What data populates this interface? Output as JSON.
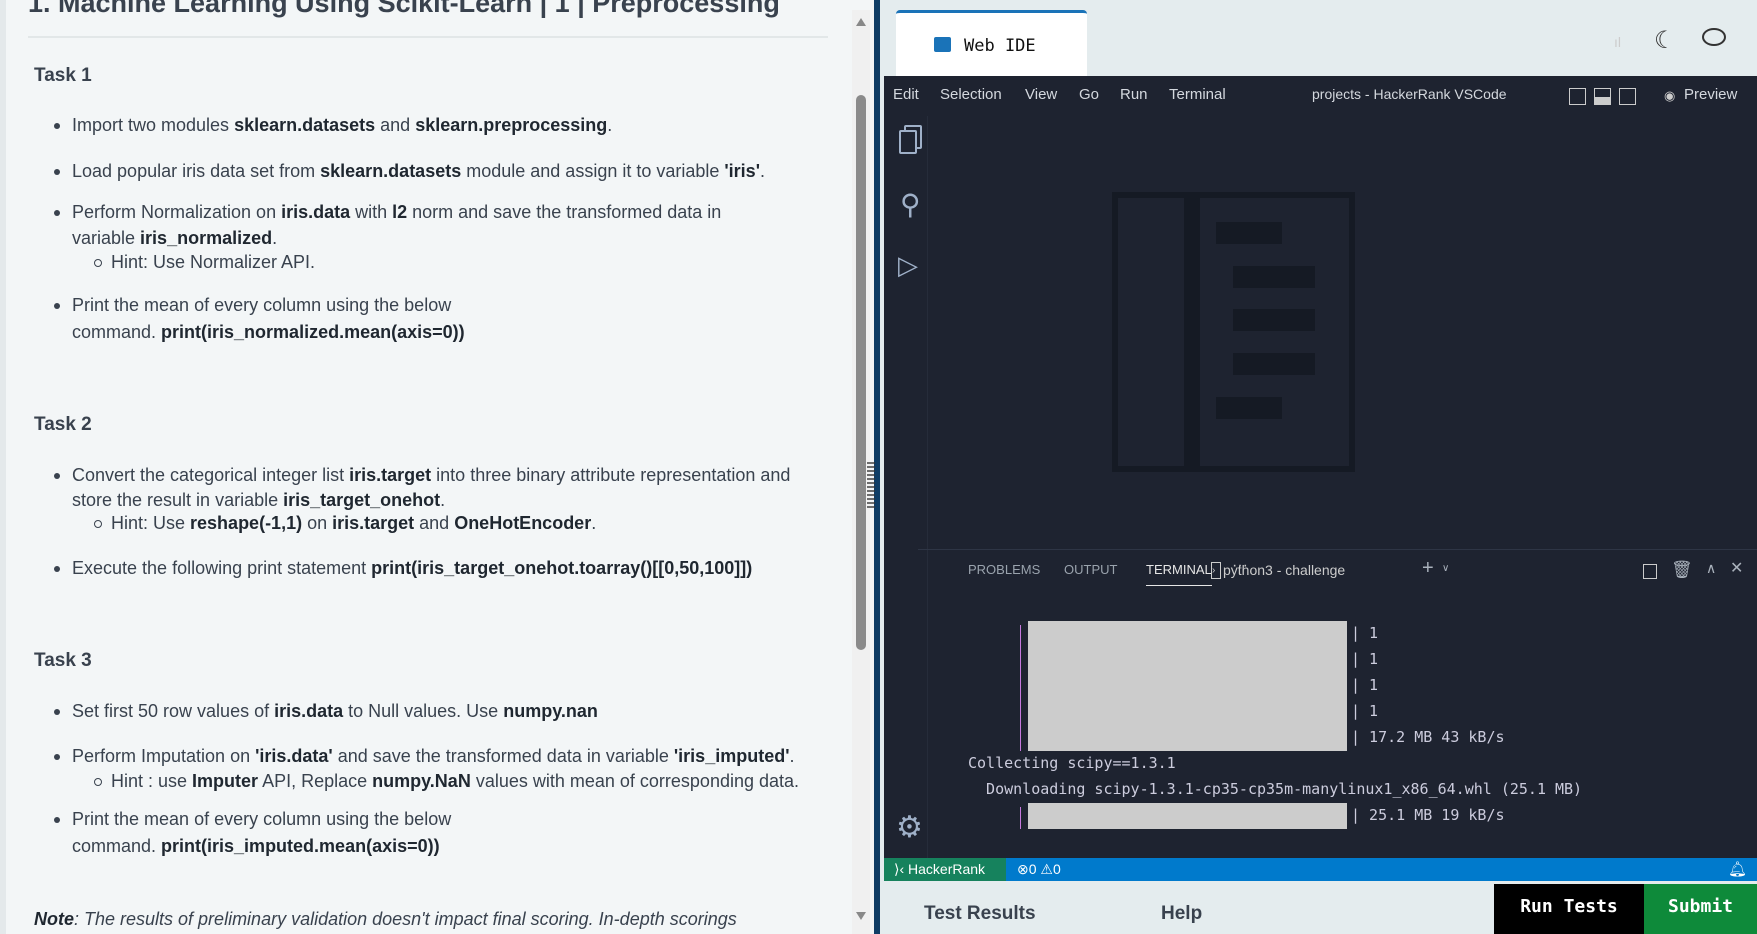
{
  "problem": {
    "title": "1. Machine Learning Using Scikit-Learn | 1 | Preprocessing",
    "task1": {
      "heading": "Task 1",
      "b1": [
        "Import two modules ",
        "sklearn.datasets",
        " and ",
        "sklearn.preprocessing",
        "."
      ],
      "b2": [
        "Load popular iris data set from ",
        "sklearn.datasets",
        " module and assign it to variable ",
        "'iris'",
        "."
      ],
      "b3a": [
        "Perform Normalization on ",
        "iris.data",
        " with ",
        "l2",
        " norm and save the transformed data in"
      ],
      "b3b": [
        "variable ",
        "iris_normalized",
        "."
      ],
      "hint": "Hint: Use Normalizer API.",
      "b4a": "Print the mean of every column using the below",
      "b4b": [
        "command. ",
        "print(iris_normalized.mean(axis=0))"
      ]
    },
    "task2": {
      "heading": "Task 2",
      "b1a": [
        "Convert the categorical integer list ",
        "iris.target",
        " into three binary attribute representation and"
      ],
      "b1b": [
        "store the result in variable ",
        "iris_target_onehot",
        "."
      ],
      "hint": [
        "Hint: Use ",
        "reshape(-1,1)",
        " on ",
        "iris.target",
        " and ",
        "OneHotEncoder",
        "."
      ],
      "b2": [
        "Execute the following print statement ",
        "print(iris_target_onehot.toarray()[[0,50,100]])"
      ]
    },
    "task3": {
      "heading": "Task 3",
      "b1": [
        "Set first 50 row values of ",
        "iris.data",
        " to Null values. Use ",
        "numpy.nan"
      ],
      "b2": [
        "Perform Imputation on ",
        "'iris.data'",
        " and save the transformed data in variable ",
        "'iris_imputed'",
        "."
      ],
      "hint": [
        "Hint : use ",
        "Imputer",
        " API, Replace ",
        "numpy.NaN",
        " values with mean of corresponding data."
      ],
      "b3a": "Print the mean of every column using the below",
      "b3b": [
        "command. ",
        "print(iris_imputed.mean(axis=0))"
      ]
    },
    "note": [
      "Note",
      ": The results of preliminary validation doesn't impact final scoring. In-depth scorings"
    ]
  },
  "ide": {
    "tab_label": "Web IDE",
    "menu": [
      "Edit",
      "Selection",
      "View",
      "Go",
      "Run",
      "Terminal"
    ],
    "window_title": "projects - HackerRank VSCode",
    "preview_label": "Preview",
    "panel_tabs": [
      "PROBLEMS",
      "OUTPUT",
      "TERMINAL"
    ],
    "active_panel_tab": "TERMINAL",
    "terminal_name": "python3 - challenge",
    "terminal_lines": [
      "| 1",
      "| 1",
      "| 1",
      "| 1",
      "| 17.2 MB 43 kB/s"
    ],
    "collecting": "Collecting scipy==1.3.1",
    "downloading": "  Downloading scipy-1.3.1-cp35-cp35m-manylinux1_x86_64.whl (25.1 MB)",
    "last_line": "| 25.1 MB 19 kB/s",
    "status_remote": "HackerRank",
    "errors": "0",
    "warnings": "0"
  },
  "footer": {
    "test_results": "Test Results",
    "help": "Help",
    "run_tests": "Run Tests",
    "submit": "Submit"
  },
  "colors": {
    "accent": "#007acc",
    "submit": "#0e8a3a",
    "remote": "#16825d",
    "editor_bg": "#1e2330"
  }
}
